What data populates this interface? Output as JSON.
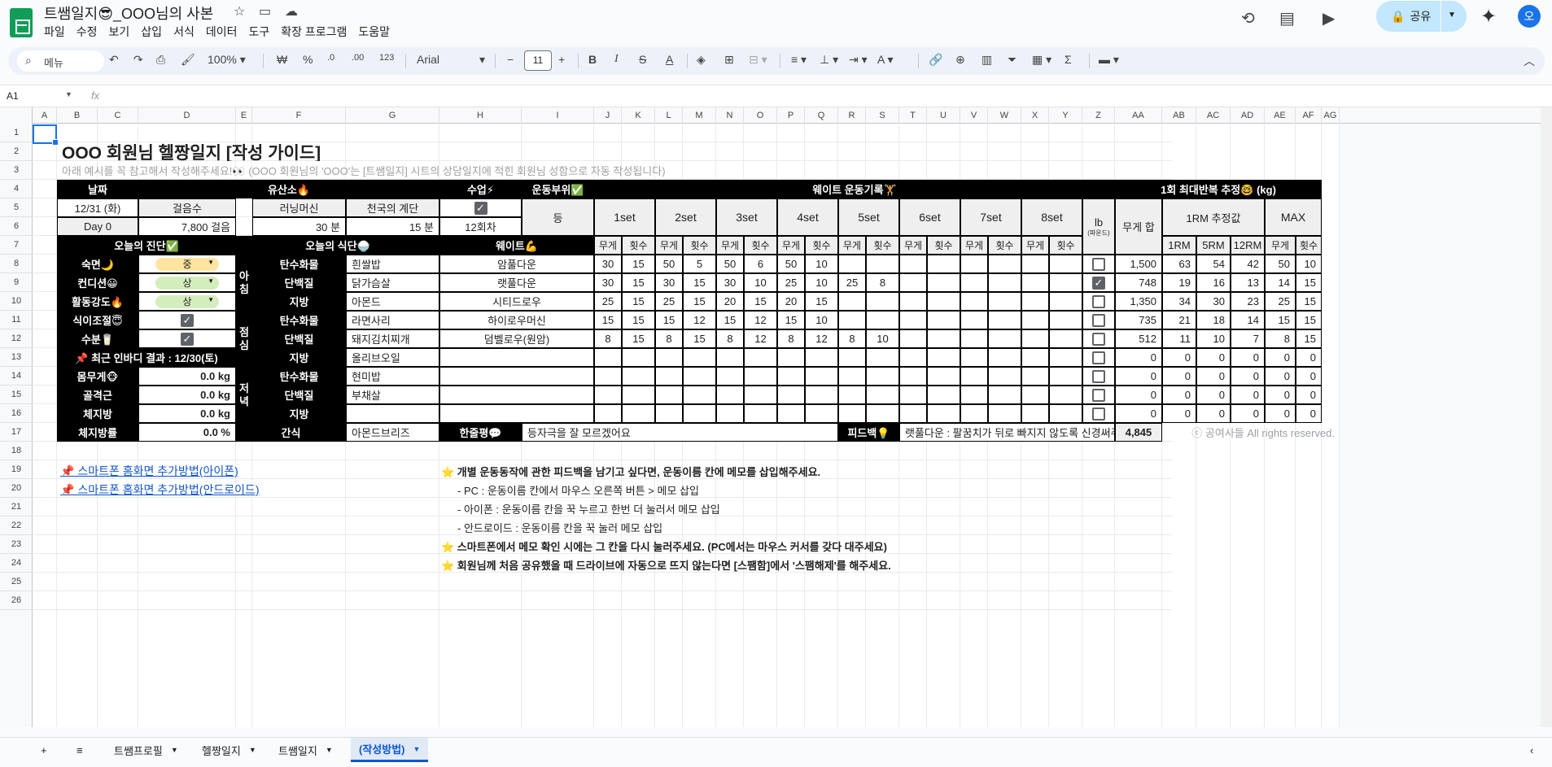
{
  "app": {
    "title": "트쌤일지😎_OOO님의 사본",
    "menu": [
      "파일",
      "수정",
      "보기",
      "삽입",
      "서식",
      "데이터",
      "도구",
      "확장 프로그램",
      "도움말"
    ],
    "share_label": "공유",
    "avatar_initial": "오"
  },
  "toolbar": {
    "search_label": "메뉴",
    "zoom": "100%",
    "currency": "₩",
    "percent": "%",
    "dec_decrease": ".0",
    "dec_increase": ".00",
    "number_format": "123",
    "font": "Arial",
    "font_size": "11"
  },
  "formula_bar": {
    "cell_ref": "A1",
    "fx": "fx",
    "value": ""
  },
  "columns": [
    "A",
    "B",
    "C",
    "D",
    "E",
    "F",
    "G",
    "H",
    "I",
    "J",
    "K",
    "L",
    "M",
    "N",
    "O",
    "P",
    "Q",
    "R",
    "S",
    "T",
    "U",
    "V",
    "W",
    "X",
    "Y",
    "Z",
    "AA",
    "AB",
    "AC",
    "AD",
    "AE",
    "AF",
    "AG"
  ],
  "rows": [
    "1",
    "2",
    "3",
    "4",
    "5",
    "6",
    "7",
    "8",
    "9",
    "10",
    "11",
    "12",
    "13",
    "14",
    "15",
    "16",
    "17",
    "18",
    "19",
    "20",
    "21",
    "22",
    "23",
    "24",
    "25",
    "26"
  ],
  "sheet": {
    "title": "OOO 회원님 헬짱일지 [작성 가이드]",
    "subtitle": "아래 예시를 꼭 참고해서 작성해주세요!👀 (OOO 회원님의 'OOO'는 [트쌤일지] 시트의 상담일지에 적힌 회원님 성함으로 자동 작성됩니다)",
    "hdr_date": "날짜",
    "hdr_aerobic": "유산소🔥",
    "hdr_class": "수업⚡",
    "hdr_part": "운동부위✅",
    "hdr_weight_rec": "웨이트 운동기록🏋",
    "hdr_1rm": "1회 최대반복 추정🤓 (kg)",
    "date": "12/31 (화)",
    "day": "Day 0",
    "steps_label": "걸음수",
    "steps": "7,800 걸음",
    "treadmill_label": "러닝머신",
    "treadmill": "30 분",
    "stairs_label": "천국의 계단",
    "stairs": "15 분",
    "class_count": "12회차",
    "part": "등",
    "sets": [
      "1set",
      "2set",
      "3set",
      "4set",
      "5set",
      "6set",
      "7set",
      "8set"
    ],
    "lb_label": "lb",
    "lb_sub": "(파운드)",
    "weight_sum_label": "무게 합",
    "rm_label": "1RM 추정값",
    "max_label": "MAX",
    "weight": "무게",
    "reps": "횟수",
    "rm_cols": [
      "1RM",
      "5RM",
      "12RM"
    ],
    "diag_hdr": "오늘의 진단✅",
    "diet_hdr": "오늘의 식단🍚",
    "weight_hdr": "웨이트💪",
    "diag": [
      {
        "label": "숙면🌙",
        "value": "중",
        "color": "#ffe5a0"
      },
      {
        "label": "컨디션😀",
        "value": "상",
        "color": "#d4edbc"
      },
      {
        "label": "활동강도🔥",
        "value": "상",
        "color": "#d4edbc"
      },
      {
        "label": "식이조절😇",
        "check": true
      },
      {
        "label": "수분🥛",
        "check": true
      }
    ],
    "inbody": "📌 최근 인바디 결과 : 12/30(토)",
    "body": [
      {
        "label": "몸무게🐵",
        "value": "0.0 kg"
      },
      {
        "label": "골격근",
        "value": "0.0 kg"
      },
      {
        "label": "체지방",
        "value": "0.0 kg"
      },
      {
        "label": "체지방률",
        "value": "0.0 %"
      }
    ],
    "meals": [
      {
        "time": "아침",
        "items": [
          [
            "탄수화물",
            "흰쌀밥"
          ],
          [
            "단백질",
            "닭가슴살"
          ],
          [
            "지방",
            "아몬드"
          ]
        ]
      },
      {
        "time": "점심",
        "items": [
          [
            "탄수화물",
            "라면사리"
          ],
          [
            "단백질",
            "돼지김치찌개"
          ],
          [
            "지방",
            "올리브오일"
          ]
        ]
      },
      {
        "time": "저녁",
        "items": [
          [
            "탄수화물",
            "현미밥"
          ],
          [
            "단백질",
            "부채살"
          ],
          [
            "지방",
            ""
          ]
        ]
      }
    ],
    "snack_label": "간식",
    "snack": "아몬드브리즈",
    "review_label": "한줄평💬",
    "review": "등자극을 잘 모르겠어요",
    "feedback_label": "피드백💡",
    "feedback": "랫풀다운 : 팔꿈치가 뒤로 빠지지 않도록 신경써주세요",
    "total": "4,845",
    "copyright": "ⓒ 공여사들 All rights reserved.",
    "exercises": [
      {
        "name": "암풀다운",
        "sets": [
          [
            "30",
            "15"
          ],
          [
            "50",
            "5"
          ],
          [
            "50",
            "6"
          ],
          [
            "50",
            "10"
          ],
          [
            "",
            ""
          ],
          [
            "",
            ""
          ],
          [
            "",
            ""
          ],
          [
            "",
            ""
          ]
        ],
        "lb": false,
        "sum": "1,500",
        "rm": [
          "63",
          "54",
          "42"
        ],
        "max": [
          "50",
          "10"
        ]
      },
      {
        "name": "랫풀다운",
        "sets": [
          [
            "30",
            "15"
          ],
          [
            "30",
            "15"
          ],
          [
            "30",
            "10"
          ],
          [
            "25",
            "10"
          ],
          [
            "25",
            "8"
          ],
          [
            "",
            ""
          ],
          [
            "",
            ""
          ],
          [
            "",
            ""
          ]
        ],
        "lb": true,
        "sum": "748",
        "rm": [
          "19",
          "16",
          "13"
        ],
        "max": [
          "14",
          "15"
        ]
      },
      {
        "name": "시티드로우",
        "sets": [
          [
            "25",
            "15"
          ],
          [
            "25",
            "15"
          ],
          [
            "20",
            "15"
          ],
          [
            "20",
            "15"
          ],
          [
            "",
            ""
          ],
          [
            "",
            ""
          ],
          [
            "",
            ""
          ],
          [
            "",
            ""
          ]
        ],
        "lb": false,
        "sum": "1,350",
        "rm": [
          "34",
          "30",
          "23"
        ],
        "max": [
          "25",
          "15"
        ]
      },
      {
        "name": "하이로우머신",
        "sets": [
          [
            "15",
            "15"
          ],
          [
            "15",
            "12"
          ],
          [
            "15",
            "12"
          ],
          [
            "15",
            "10"
          ],
          [
            "",
            ""
          ],
          [
            "",
            ""
          ],
          [
            "",
            ""
          ],
          [
            "",
            ""
          ]
        ],
        "lb": false,
        "sum": "735",
        "rm": [
          "21",
          "18",
          "14"
        ],
        "max": [
          "15",
          "15"
        ]
      },
      {
        "name": "덤벨로우(원암)",
        "sets": [
          [
            "8",
            "15"
          ],
          [
            "8",
            "15"
          ],
          [
            "8",
            "12"
          ],
          [
            "8",
            "12"
          ],
          [
            "8",
            "10"
          ],
          [
            "",
            ""
          ],
          [
            "",
            ""
          ],
          [
            "",
            ""
          ]
        ],
        "lb": false,
        "sum": "512",
        "rm": [
          "11",
          "10",
          "7"
        ],
        "max": [
          "8",
          "15"
        ]
      },
      {
        "name": "",
        "sets": [
          [
            "",
            ""
          ],
          [
            "",
            ""
          ],
          [
            "",
            ""
          ],
          [
            "",
            ""
          ],
          [
            "",
            ""
          ],
          [
            "",
            ""
          ],
          [
            "",
            ""
          ],
          [
            "",
            ""
          ]
        ],
        "lb": false,
        "sum": "0",
        "rm": [
          "0",
          "0",
          "0"
        ],
        "max": [
          "0",
          "0"
        ]
      },
      {
        "name": "",
        "sets": [
          [
            "",
            ""
          ],
          [
            "",
            ""
          ],
          [
            "",
            ""
          ],
          [
            "",
            ""
          ],
          [
            "",
            ""
          ],
          [
            "",
            ""
          ],
          [
            "",
            ""
          ],
          [
            "",
            ""
          ]
        ],
        "lb": false,
        "sum": "0",
        "rm": [
          "0",
          "0",
          "0"
        ],
        "max": [
          "0",
          "0"
        ]
      },
      {
        "name": "",
        "sets": [
          [
            "",
            ""
          ],
          [
            "",
            ""
          ],
          [
            "",
            ""
          ],
          [
            "",
            ""
          ],
          [
            "",
            ""
          ],
          [
            "",
            ""
          ],
          [
            "",
            ""
          ],
          [
            "",
            ""
          ]
        ],
        "lb": false,
        "sum": "0",
        "rm": [
          "0",
          "0",
          "0"
        ],
        "max": [
          "0",
          "0"
        ]
      },
      {
        "name": "",
        "sets": [
          [
            "",
            ""
          ],
          [
            "",
            ""
          ],
          [
            "",
            ""
          ],
          [
            "",
            ""
          ],
          [
            "",
            ""
          ],
          [
            "",
            ""
          ],
          [
            "",
            ""
          ],
          [
            "",
            ""
          ]
        ],
        "lb": false,
        "sum": "0",
        "rm": [
          "0",
          "0",
          "0"
        ],
        "max": [
          "0",
          "0"
        ]
      }
    ],
    "links": [
      "📌 스마트폰 홈화면 추가방법(아이폰)",
      "📌 스마트폰 홈화면 추가방법(안드로이드)"
    ],
    "notes": [
      "⭐ 개별 운동동작에 관한 피드백을 남기고 싶다면, 운동이름 칸에 메모를 삽입해주세요.",
      "- PC : 운동이름 칸에서 마우스 오른쪽 버튼 > 메모 삽입",
      "- 아이폰 : 운동이름 칸을 꾹 누르고 한번 더 눌러서 메모 삽입",
      "- 안드로이드 : 운동이름 칸을 꾹 눌러 메모 삽입",
      "⭐ 스마트폰에서 메모 확인 시에는 그 칸을 다시 눌러주세요. (PC에서는 마우스 커서를 갖다 대주세요)",
      "⭐ 회원님께 처음 공유했을 때 드라이브에 자동으로 뜨지 않는다면 [스팸함]에서 '스팸해제'를 해주세요."
    ]
  },
  "tabs": [
    "트쌤프로필",
    "헬짱일지",
    "트쌤일지",
    "(작성방법)"
  ],
  "active_tab": 3
}
